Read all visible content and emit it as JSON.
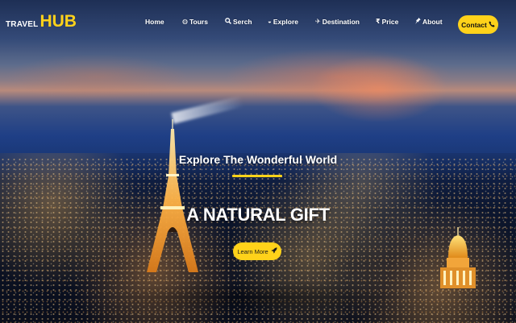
{
  "brand": {
    "prefix": "TRAVEL",
    "name": "HUB"
  },
  "nav": {
    "items": [
      {
        "label": "Home",
        "icon": ""
      },
      {
        "label": "Tours",
        "icon": "globe-icon"
      },
      {
        "label": "Serch",
        "icon": "search-icon"
      },
      {
        "label": "Explore",
        "icon": "compass-icon"
      },
      {
        "label": "Destination",
        "icon": "plane-icon"
      },
      {
        "label": "Price",
        "icon": "rupee-icon"
      },
      {
        "label": "About",
        "icon": "pin-icon"
      }
    ],
    "contact_label": "Contact",
    "contact_icon": "phone-icon"
  },
  "hero": {
    "subtitle": "Explore The Wonderful World",
    "headline": "A NATURAL GIFT",
    "cta_label": "Learn More",
    "cta_icon": "rocket-icon"
  },
  "colors": {
    "accent": "#ffd21a",
    "text": "#ffffff"
  }
}
